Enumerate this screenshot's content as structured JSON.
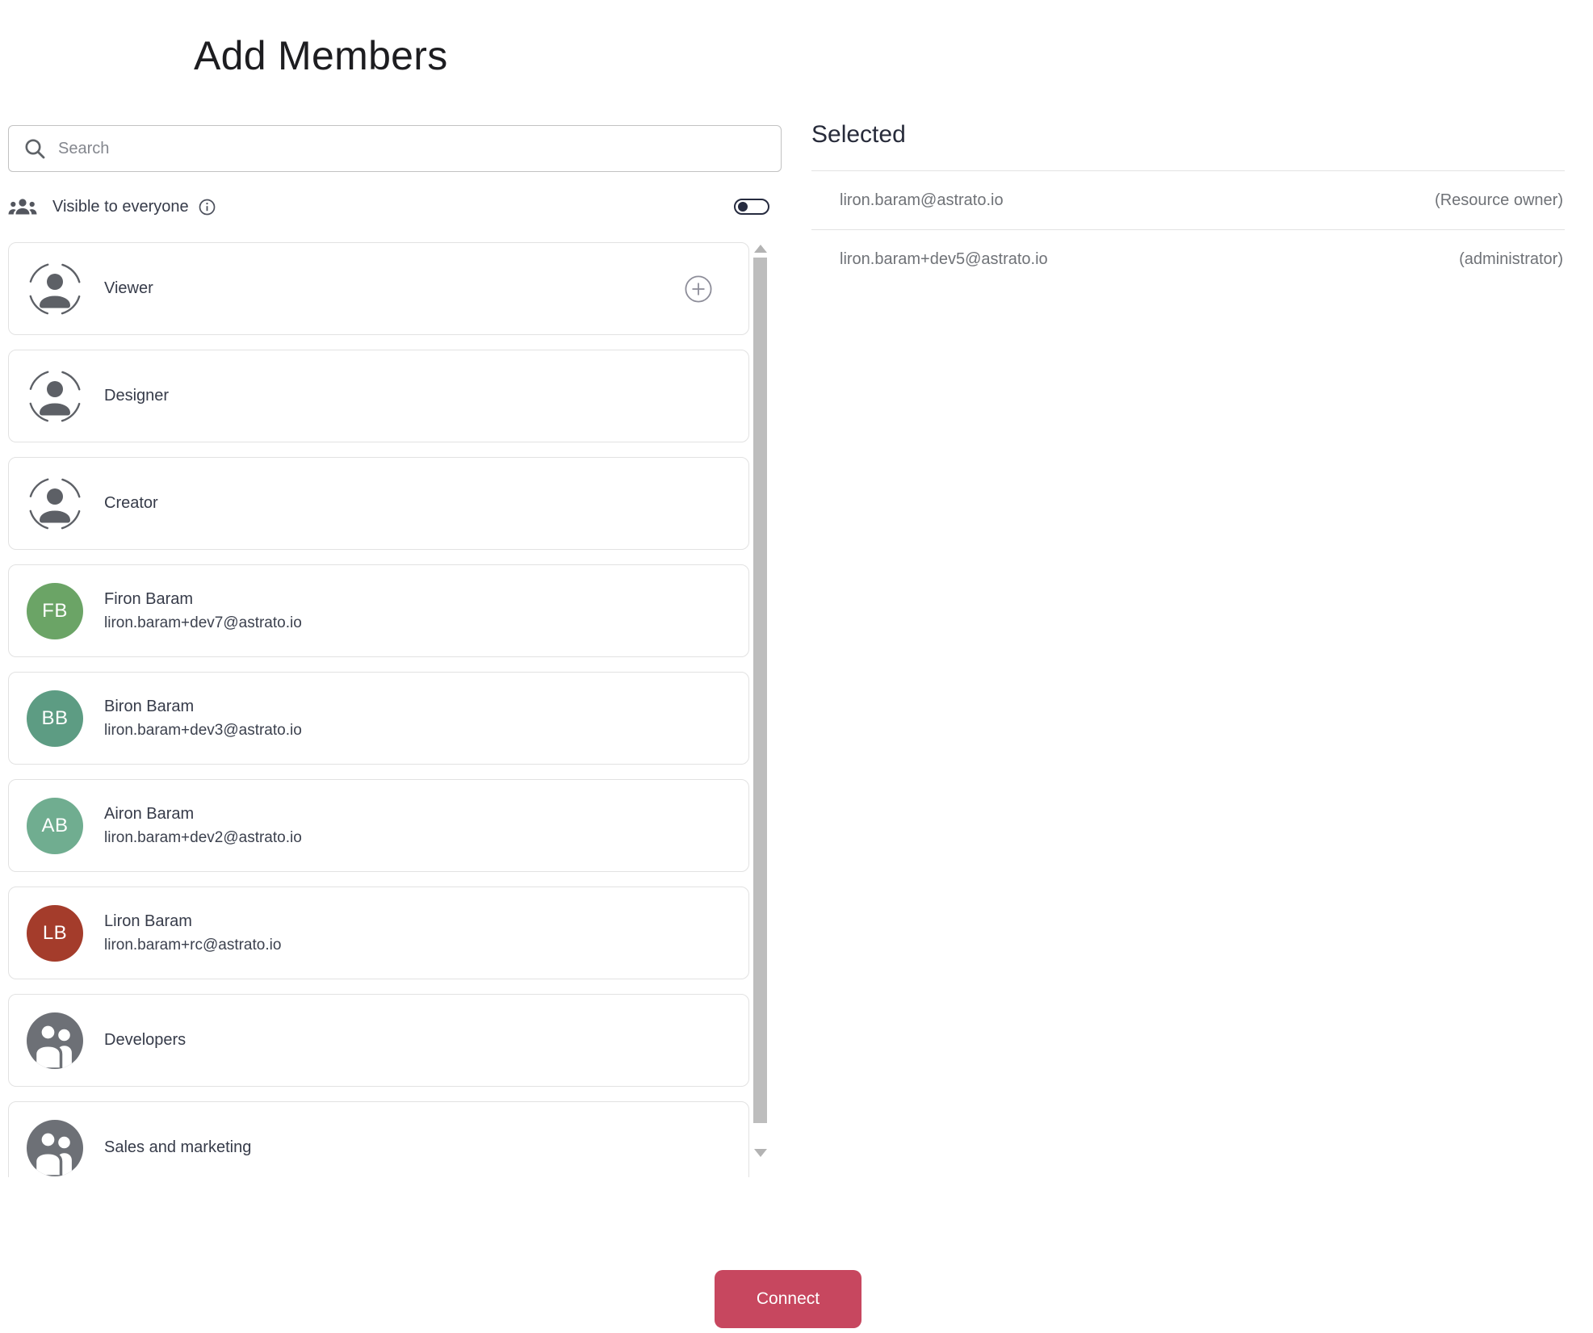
{
  "title": "Add Members",
  "search": {
    "placeholder": "Search"
  },
  "visibility": {
    "label": "Visible to everyone",
    "toggle_on": false
  },
  "member_list": [
    {
      "type": "role",
      "label": "Viewer",
      "has_add": true
    },
    {
      "type": "role",
      "label": "Designer"
    },
    {
      "type": "role",
      "label": "Creator"
    },
    {
      "type": "user",
      "name": "Firon Baram",
      "email": "liron.baram+dev7@astrato.io",
      "initials": "FB",
      "color": "#6ba466"
    },
    {
      "type": "user",
      "name": "Biron Baram",
      "email": "liron.baram+dev3@astrato.io",
      "initials": "BB",
      "color": "#5d9c83"
    },
    {
      "type": "user",
      "name": "Airon Baram",
      "email": "liron.baram+dev2@astrato.io",
      "initials": "AB",
      "color": "#70ad90"
    },
    {
      "type": "user",
      "name": "Liron Baram",
      "email": "liron.baram+rc@astrato.io",
      "initials": "LB",
      "color": "#a43c2b"
    },
    {
      "type": "group",
      "label": "Developers"
    },
    {
      "type": "group",
      "label": "Sales and marketing"
    }
  ],
  "selected": {
    "heading": "Selected",
    "rows": [
      {
        "email": "liron.baram@astrato.io",
        "role": "(Resource owner)"
      },
      {
        "email": "liron.baram+dev5@astrato.io",
        "role": "(administrator)"
      }
    ]
  },
  "footer": {
    "connect_label": "Connect"
  },
  "colors": {
    "accent_button": "#c7475f",
    "toggle": "#262b3f",
    "card_border": "#e2e2e2",
    "muted_text": "#6f7277"
  }
}
